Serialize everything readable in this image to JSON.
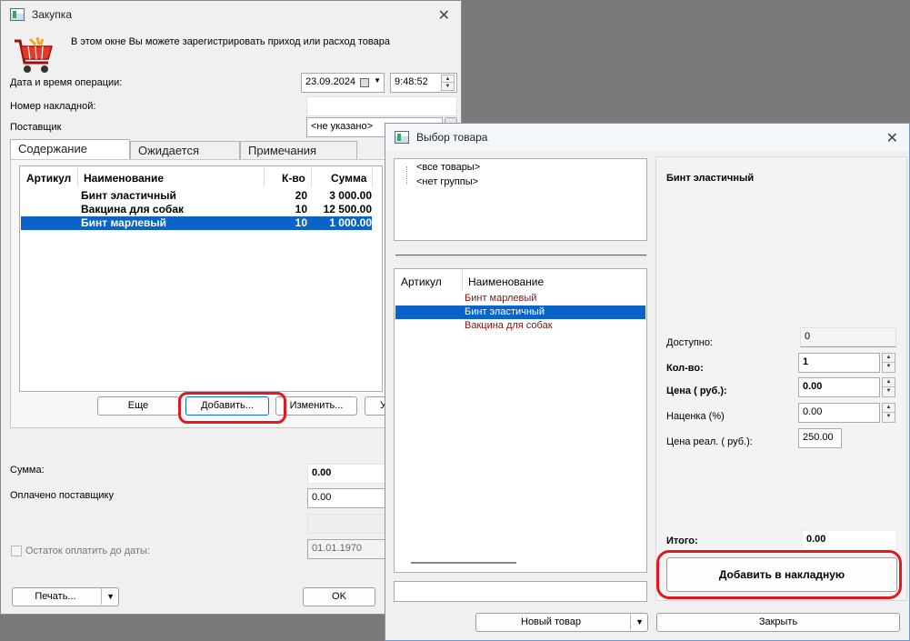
{
  "purchase": {
    "title": "Закупка",
    "intro": "В этом окне Вы можете зарегистрировать приход или расход товара",
    "date_time_label": "Дата и время операции:",
    "date": "23.09.2024",
    "time": "9:48:52",
    "invoice_label": "Номер накладной:",
    "invoice_value": "",
    "supplier_label": "Поставщик",
    "supplier_value": "<не указано>",
    "tabs": [
      "Содержание",
      "Ожидается",
      "Примечания"
    ],
    "columns": [
      "Артикул",
      "Наименование",
      "К-во",
      "Сумма"
    ],
    "rows": [
      {
        "article": "",
        "name": "Бинт эластичный",
        "qty": "20",
        "sum": "3 000.00"
      },
      {
        "article": "",
        "name": "Вакцина для собак",
        "qty": "10",
        "sum": "12 500.00"
      },
      {
        "article": "",
        "name": "Бинт марлевый",
        "qty": "10",
        "sum": "1 000.00"
      }
    ],
    "buttons": {
      "more": "Еще",
      "add": "Добавить...",
      "edit": "Изменить...",
      "delete_partial": "У"
    },
    "sum_label": "Сумма:",
    "sum_value": "0.00",
    "paid_label": "Оплачено поставщику",
    "paid_value": "0.00",
    "remainder_label": "Остаток оплатить до даты:",
    "remainder_date": "01.01.1970",
    "print_label": "Печать...",
    "ok_label": "OK"
  },
  "picker": {
    "title": "Выбор товара",
    "tree": [
      "<все товары>",
      "<нет группы>"
    ],
    "columns": [
      "Артикул",
      "Наименование"
    ],
    "items": [
      {
        "name": "Бинт марлевый",
        "selected": false
      },
      {
        "name": "Бинт эластичный",
        "selected": true
      },
      {
        "name": "Вакцина для собак",
        "selected": false
      }
    ],
    "product_name": "Бинт эластичный",
    "available_label": "Доступно:",
    "available_value": "0",
    "qty_label": "Кол-во:",
    "qty_value": "1",
    "price_label": "Цена ( руб.):",
    "price_value": "0.00",
    "markup_label": "Наценка (%)",
    "markup_value": "0.00",
    "retail_label": "Цена реал. ( руб.):",
    "retail_value": "250.00",
    "total_label": "Итого:",
    "total_value": "0.00",
    "add_to_invoice": "Добавить в накладную",
    "new_item": "Новый товар",
    "close": "Закрыть"
  },
  "colors": {
    "selection": "#0a63c9",
    "highlight_ring": "#e01a22",
    "item_text": "#8b1010"
  }
}
